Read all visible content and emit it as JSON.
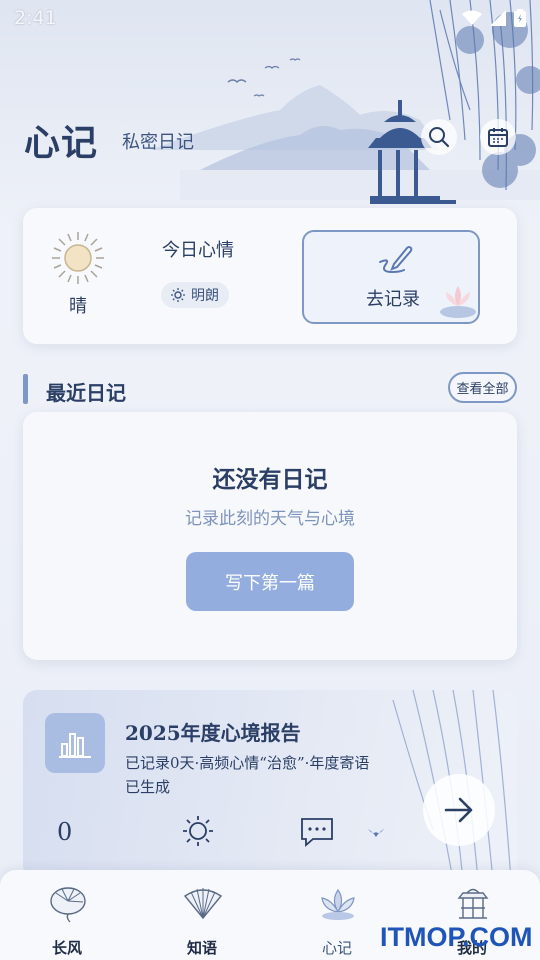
{
  "status_bar": {
    "time": "2:41"
  },
  "header": {
    "title": "心记",
    "subtitle": "私密日记"
  },
  "mood_card": {
    "weather": "晴",
    "mood_title": "今日心情",
    "mood_value": "明朗",
    "record_label": "去记录"
  },
  "recent": {
    "title": "最近日记",
    "view_all": "查看全部"
  },
  "empty_state": {
    "title": "还没有日记",
    "description": "记录此刻的天气与心境",
    "button": "写下第一篇"
  },
  "report": {
    "title": "2025年度心境报告",
    "description": "已记录0天·高频心情“治愈”·年度寄语已生成",
    "count": "0"
  },
  "nav": [
    {
      "label": "长风",
      "icon": "lotus-leaf-icon"
    },
    {
      "label": "知语",
      "icon": "folding-fan-icon"
    },
    {
      "label": "心记",
      "icon": "lotus-flower-icon",
      "active": true
    },
    {
      "label": "我的",
      "icon": "pavilion-icon"
    }
  ],
  "watermark": "ITMOP.COM",
  "colors": {
    "accent": "#7f97c4",
    "primary_text": "#2b3f66",
    "button": "#93aede"
  }
}
